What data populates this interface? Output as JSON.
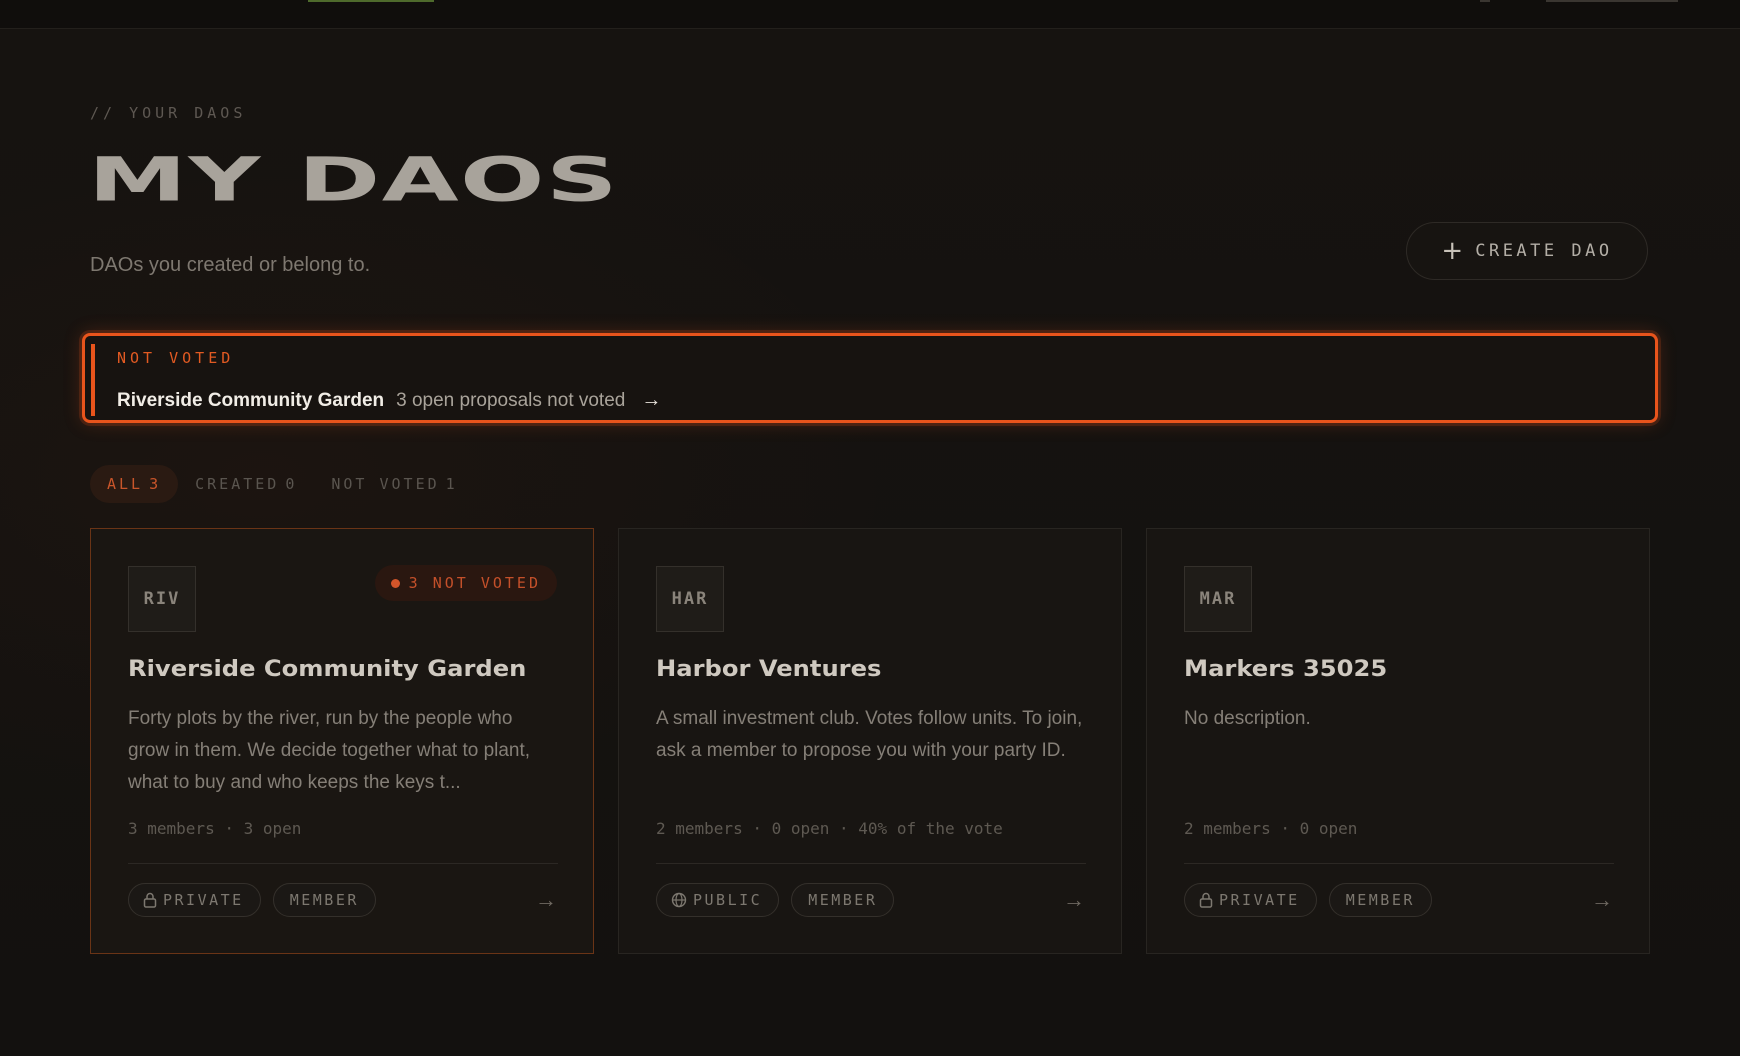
{
  "header": {
    "eyebrow": "// YOUR DAOS",
    "title": "MY DAOS",
    "subtitle": "DAOs you created or belong to.",
    "create_button_label": "CREATE DAO"
  },
  "alert": {
    "tag": "NOT VOTED",
    "dao_name": "Riverside Community Garden",
    "detail": "3 open proposals not voted"
  },
  "tabs": [
    {
      "label": "ALL",
      "count": "3",
      "active": true
    },
    {
      "label": "CREATED",
      "count": "0",
      "active": false
    },
    {
      "label": "NOT VOTED",
      "count": "1",
      "active": false
    }
  ],
  "cards": [
    {
      "code": "RIV",
      "badge": "3 NOT VOTED",
      "name": "Riverside Community Garden",
      "description": "Forty plots by the river, run by the people who grow in them. We decide together what to plant, what to buy and who keeps the keys t...",
      "stats": "3 members · 3 open",
      "visibility": "PRIVATE",
      "role": "MEMBER"
    },
    {
      "code": "HAR",
      "badge": "",
      "name": "Harbor Ventures",
      "description": "A small investment club. Votes follow units. To join, ask a member to propose you with your party ID.",
      "stats": "2 members · 0 open · 40% of the vote",
      "visibility": "PUBLIC",
      "role": "MEMBER"
    },
    {
      "code": "MAR",
      "badge": "",
      "name": "Markers 35025",
      "description": "No description.",
      "stats": "2 members · 0 open",
      "visibility": "PRIVATE",
      "role": "MEMBER"
    }
  ],
  "colors": {
    "accent": "#e8541c",
    "background": "#141210",
    "card_background": "#181512"
  }
}
